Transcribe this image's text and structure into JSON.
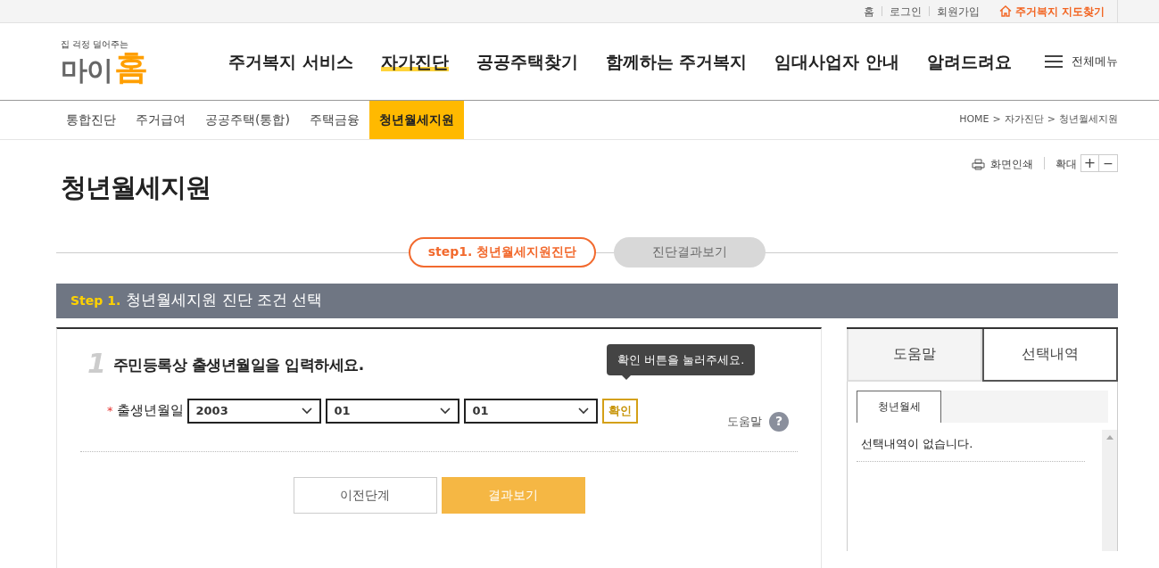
{
  "top_links": [
    {
      "label": "홈"
    },
    {
      "label": "로그인"
    },
    {
      "label": "회원가입"
    }
  ],
  "map_link": {
    "label": "주거복지 지도찾기"
  },
  "logo": {
    "tagline": "집 걱정 덜어주는",
    "name_part_1": "마이",
    "name_part_2": "홈"
  },
  "main_nav": [
    {
      "label": "주거복지 서비스",
      "selected": false
    },
    {
      "label": "자가진단",
      "selected": true
    },
    {
      "label": "공공주택찾기",
      "selected": false
    },
    {
      "label": "함께하는 주거복지",
      "selected": false
    },
    {
      "label": "임대사업자 안내",
      "selected": false
    },
    {
      "label": "알려드려요",
      "selected": false
    }
  ],
  "all_menu": {
    "label": "전체메뉴"
  },
  "sub_nav": [
    {
      "label": "통합진단",
      "selected": false
    },
    {
      "label": "주거급여",
      "selected": false
    },
    {
      "label": "공공주택(통합)",
      "selected": false
    },
    {
      "label": "주택금융",
      "selected": false
    },
    {
      "label": "청년월세지원",
      "selected": true
    }
  ],
  "breadcrumb": [
    "HOME",
    "자가진단",
    "청년월세지원"
  ],
  "breadcrumb_separator": ">",
  "page_title": "청년월세지원",
  "tools": {
    "print": "화면인쇄",
    "zoom": "확대",
    "zoom_in": "+",
    "zoom_out": "−"
  },
  "steps": [
    {
      "label": "step1. 청년월세지원진단",
      "selected": true
    },
    {
      "label": "진단결과보기",
      "selected": false
    }
  ],
  "section": {
    "step": "Step 1.",
    "title": "청년월세지원 진단 조건 선택"
  },
  "question": {
    "number": "1",
    "text": "주민등록상 출생년월일을 입력하세요.",
    "required_mark": "*",
    "label": "출생년월일",
    "selects": [
      {
        "value": "2003"
      },
      {
        "value": "01"
      },
      {
        "value": "01"
      }
    ],
    "confirm": "확인",
    "tooltip": "확인 버튼을 눌러주세요.",
    "help": "도움말",
    "help_icon": "?"
  },
  "buttons": [
    {
      "label": "이전단계",
      "kind": "secondary"
    },
    {
      "label": "결과보기",
      "kind": "primary"
    }
  ],
  "side_tabs": [
    {
      "label": "도움말",
      "selected": false
    },
    {
      "label": "선택내역",
      "selected": true
    }
  ],
  "side_subtabs": [
    {
      "label": "청년월세",
      "selected": true
    }
  ],
  "side_empty": "선택내역이 없습니다."
}
